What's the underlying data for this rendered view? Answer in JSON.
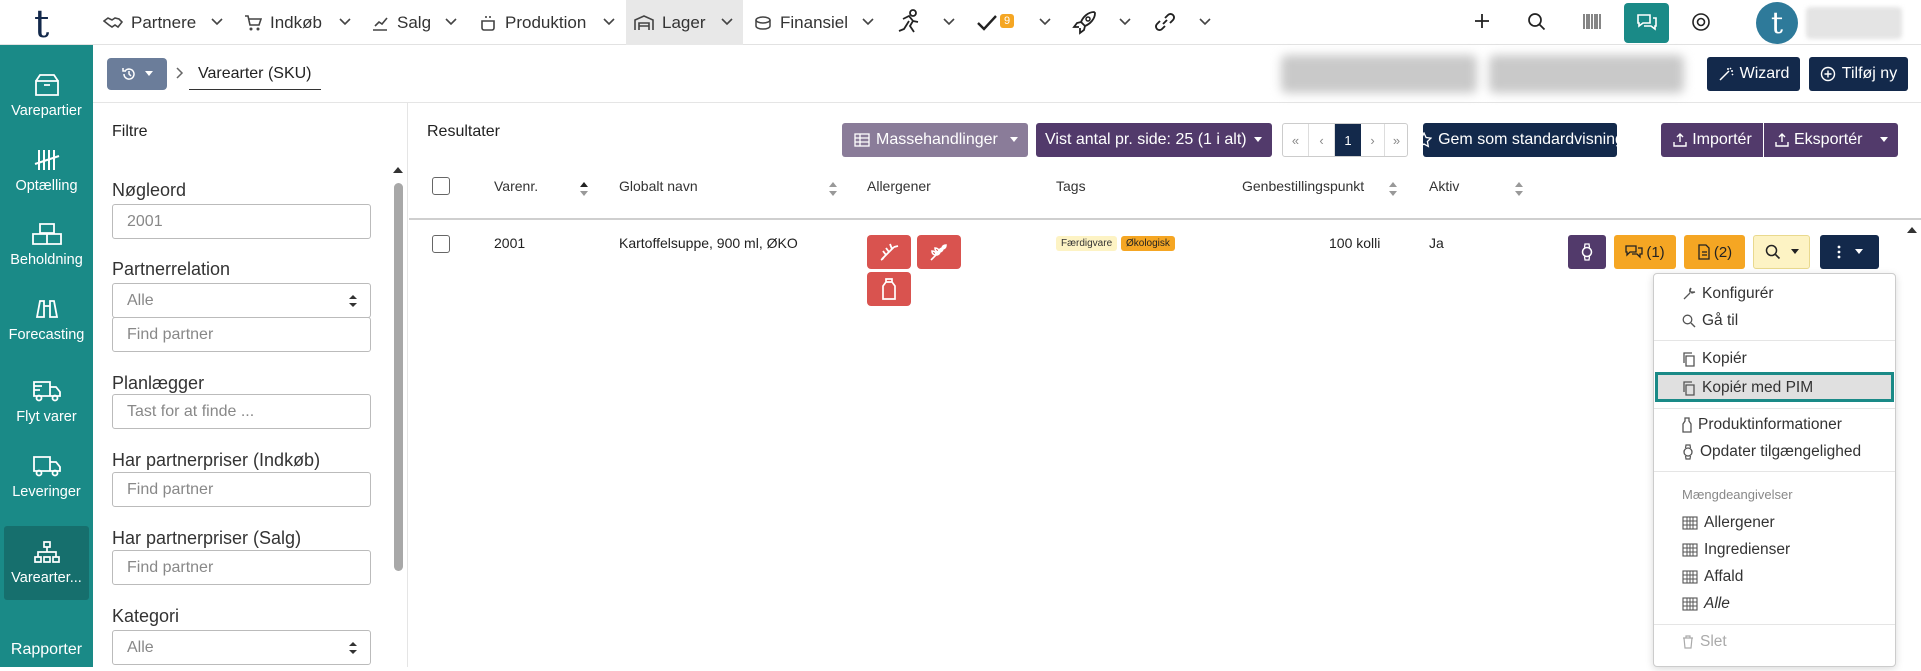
{
  "topnav": {
    "logo": "t",
    "items": [
      {
        "label": "Partnere",
        "icon": "handshake-icon"
      },
      {
        "label": "Indkøb",
        "icon": "cart-icon"
      },
      {
        "label": "Salg",
        "icon": "sales-icon"
      },
      {
        "label": "Produktion",
        "icon": "pot-icon"
      },
      {
        "label": "Lager",
        "icon": "warehouse-icon"
      },
      {
        "label": "Finansiel",
        "icon": "coins-icon"
      }
    ],
    "tasks_badge": "9"
  },
  "sidebar": {
    "items": [
      {
        "label": "Varepartier",
        "icon": "box-icon"
      },
      {
        "label": "Optælling",
        "icon": "tally-icon"
      },
      {
        "label": "Beholdning",
        "icon": "boxes-icon"
      },
      {
        "label": "Forecasting",
        "icon": "binoculars-icon"
      },
      {
        "label": "Flyt varer",
        "icon": "truck-move-icon"
      },
      {
        "label": "Leveringer",
        "icon": "truck-icon"
      },
      {
        "label": "Varearter...",
        "icon": "sitemap-icon"
      },
      {
        "label": "Rapporter",
        "icon": ""
      }
    ]
  },
  "breadcrumb": {
    "current": "Varearter (SKU)"
  },
  "header": {
    "wizard_label": "Wizard",
    "add_label": "Tilføj ny"
  },
  "filters": {
    "title": "Filtre",
    "fields": [
      {
        "label": "Nøgleord",
        "value": "2001",
        "placeholder": ""
      },
      {
        "label": "Partnerrelation",
        "value": "Alle",
        "placeholder": ""
      },
      {
        "label": "",
        "value": "",
        "placeholder": "Find partner"
      },
      {
        "label": "Planlægger",
        "value": "",
        "placeholder": "Tast for at finde ..."
      },
      {
        "label": "Har partnerpriser (Indkøb)",
        "value": "",
        "placeholder": "Find partner"
      },
      {
        "label": "Har partnerpriser (Salg)",
        "value": "",
        "placeholder": "Find partner"
      },
      {
        "label": "Kategori",
        "value": "Alle",
        "placeholder": ""
      }
    ]
  },
  "results": {
    "title": "Resultater",
    "mass_actions_label": "Massehandlinger",
    "page_size_label": "Vist antal pr. side: 25 (1 i alt)",
    "pagination": {
      "first": "«",
      "prev": "‹",
      "current": "1",
      "next": "›",
      "last": "»"
    },
    "save_default_label": "Gem som standardvisning",
    "import_label": "Importér",
    "export_label": "Eksportér",
    "columns": [
      "Varenr.",
      "Globalt navn",
      "Allergener",
      "Tags",
      "Genbestillingspunkt",
      "Aktiv"
    ],
    "rows": [
      {
        "varenr": "2001",
        "name": "Kartoffelsuppe, 900 ml, ØKO",
        "allergens": [
          "celery-icon",
          "gluten-icon",
          "milk-icon"
        ],
        "tags": [
          {
            "label": "Færdigvare",
            "color": "#fdf3c4"
          },
          {
            "label": "Økologisk",
            "color": "#f5a623"
          }
        ],
        "reorder": "100 kolli",
        "active": "Ja",
        "comments": "(1)",
        "documents": "(2)"
      }
    ]
  },
  "menu": {
    "items": [
      {
        "label": "Konfigurér",
        "icon": "wrench-icon"
      },
      {
        "label": "Gå til",
        "icon": "search-icon"
      },
      {
        "label": "Kopiér",
        "icon": "copy-icon"
      },
      {
        "label": "Kopiér med PIM",
        "icon": "copy-icon"
      },
      {
        "label": "Produktinformationer",
        "icon": "bottle-icon"
      },
      {
        "label": "Opdater tilgængelighed",
        "icon": "watch-icon"
      }
    ],
    "section_label": "Mængdeangivelser",
    "section_items": [
      {
        "label": "Allergener",
        "icon": "grid-icon"
      },
      {
        "label": "Ingredienser",
        "icon": "grid-icon"
      },
      {
        "label": "Affald",
        "icon": "grid-icon"
      },
      {
        "label": "Alle",
        "icon": "grid-icon"
      }
    ],
    "delete_label": "Slet"
  },
  "colors": {
    "teal": "#1a8a87",
    "dark_navy": "#13294b",
    "purple": "#523a6b",
    "orange": "#f5a623",
    "allergen_red": "#d9534f",
    "highlight": "#1a8a87"
  }
}
